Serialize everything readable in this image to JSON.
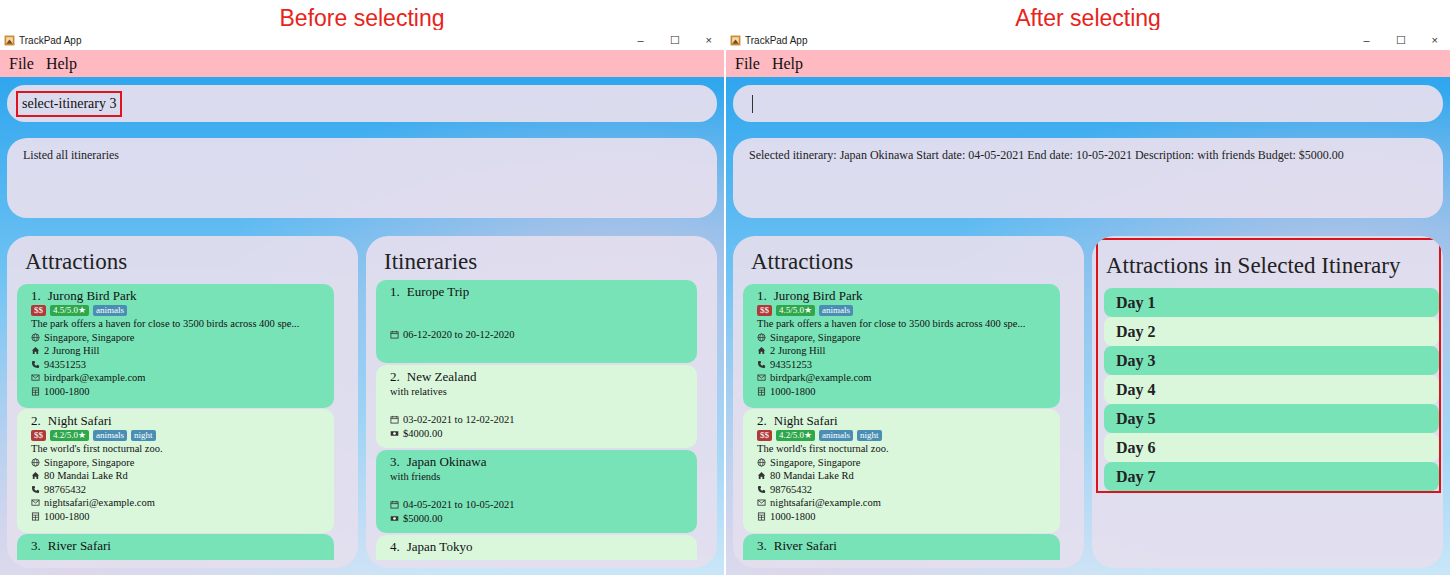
{
  "windows": [
    {
      "caption": "Before selecting",
      "title": "TrackPad App",
      "controls": [
        "–",
        "☐",
        "×"
      ],
      "menu": [
        "File",
        "Help"
      ],
      "command": {
        "value": "select-itinerary 3",
        "highlighted": true,
        "focused": false
      },
      "result": "Listed all itineraries",
      "attractions": {
        "title": "Attractions",
        "items": [
          {
            "index": "1.",
            "name": "Jurong Bird Park",
            "price": "$$",
            "rating": "4.5/5.0★",
            "tags": [
              "animals"
            ],
            "description": "The park offers a haven for close to 3500 birds across 400 spe...",
            "location": "Singapore, Singapore",
            "address": "2 Jurong Hill",
            "phone": "94351253",
            "email": "birdpark@example.com",
            "hours": "1000-1800"
          },
          {
            "index": "2.",
            "name": "Night Safari",
            "price": "$$",
            "rating": "4.2/5.0★",
            "tags": [
              "animals",
              "night"
            ],
            "description": "The world's first nocturnal zoo.",
            "location": "Singapore, Singapore",
            "address": "80 Mandai Lake Rd",
            "phone": "98765432",
            "email": "nightsafari@example.com",
            "hours": "1000-1800"
          },
          {
            "index": "3.",
            "name": "River Safari"
          }
        ]
      },
      "side": {
        "kind": "itineraries",
        "title": "Itineraries",
        "highlighted": false,
        "itineraries": [
          {
            "index": "1.",
            "name": "Europe Trip",
            "dates": "06-12-2020 to 20-12-2020"
          },
          {
            "index": "2.",
            "name": "New Zealand",
            "description": "with relatives",
            "dates": "03-02-2021 to 12-02-2021",
            "budget": "$4000.00"
          },
          {
            "index": "3.",
            "name": "Japan Okinawa",
            "description": "with friends",
            "dates": "04-05-2021 to 10-05-2021",
            "budget": "$5000.00"
          },
          {
            "index": "4.",
            "name": "Japan Tokyo"
          }
        ]
      }
    },
    {
      "caption": "After selecting",
      "title": "TrackPad App",
      "controls": [
        "–",
        "☐",
        "×"
      ],
      "menu": [
        "File",
        "Help"
      ],
      "command": {
        "value": "",
        "highlighted": false,
        "focused": true
      },
      "result": "Selected itinerary: Japan Okinawa Start date: 04-05-2021 End date: 10-05-2021 Description: with friends Budget: $5000.00",
      "attractions": {
        "title": "Attractions",
        "items": [
          {
            "index": "1.",
            "name": "Jurong Bird Park",
            "price": "$$",
            "rating": "4.5/5.0★",
            "tags": [
              "animals"
            ],
            "description": "The park offers a haven for close to 3500 birds across 400 spe...",
            "location": "Singapore, Singapore",
            "address": "2 Jurong Hill",
            "phone": "94351253",
            "email": "birdpark@example.com",
            "hours": "1000-1800"
          },
          {
            "index": "2.",
            "name": "Night Safari",
            "price": "$$",
            "rating": "4.2/5.0★",
            "tags": [
              "animals",
              "night"
            ],
            "description": "The world's first nocturnal zoo.",
            "location": "Singapore, Singapore",
            "address": "80 Mandai Lake Rd",
            "phone": "98765432",
            "email": "nightsafari@example.com",
            "hours": "1000-1800"
          },
          {
            "index": "3.",
            "name": "River Safari"
          }
        ]
      },
      "side": {
        "kind": "days",
        "title": "Attractions in Selected Itinerary",
        "highlighted": true,
        "days": [
          {
            "label": "Day 1"
          },
          {
            "label": "Day 2"
          },
          {
            "label": "Day 3"
          },
          {
            "label": "Day 4"
          },
          {
            "label": "Day 5"
          },
          {
            "label": "Day 6"
          },
          {
            "label": "Day 7"
          }
        ]
      }
    }
  ]
}
